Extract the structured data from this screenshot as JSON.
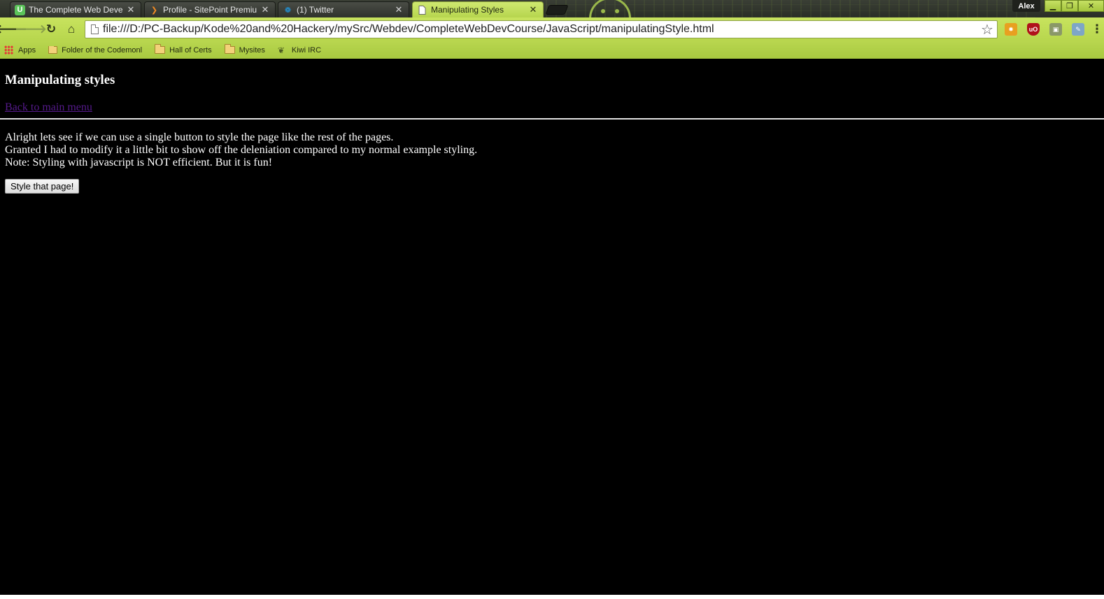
{
  "browser": {
    "profile_name": "Alex",
    "tabs": [
      {
        "title": "The Complete Web Develop",
        "favicon": "U",
        "favicon_color": "#5cc35a",
        "active": false
      },
      {
        "title": "Profile - SitePoint Premium",
        "favicon": "❯",
        "favicon_color": "#f08a24",
        "active": false
      },
      {
        "title": "(1) Twitter",
        "favicon": "❁",
        "favicon_color": "#1da1f2",
        "active": false
      },
      {
        "title": "Manipulating Styles",
        "favicon": "page-icon",
        "favicon_color": "#555555",
        "active": true
      }
    ],
    "address": "file:///D:/PC-Backup/Kode%20and%20Hackery/mySrc/Webdev/CompleteWebDevCourse/JavaScript/manipulatingStyle.html",
    "bookmarks": [
      {
        "label": "Apps",
        "icon": "apps-icon"
      },
      {
        "label": "Folder of the Codemonl",
        "icon": "folder-icon"
      },
      {
        "label": "Hall of Certs",
        "icon": "folder-icon"
      },
      {
        "label": "Mysites",
        "icon": "folder-icon"
      },
      {
        "label": "Kiwi IRC",
        "icon": "leaf-icon"
      }
    ],
    "theme_accent": "#b7d64d"
  },
  "page": {
    "heading": "Manipulating styles",
    "back_link": "Back to main menu",
    "lines": [
      "Alright lets see if we can use a single button to style the page like the rest of the pages.",
      "Granted I had to modify it a little bit to show off the deleniation compared to my normal example styling.",
      "Note: Styling with javascript is NOT efficient. But it is fun!"
    ],
    "button_label": "Style that page!",
    "background": "#000000",
    "link_color": "#551a8b"
  }
}
